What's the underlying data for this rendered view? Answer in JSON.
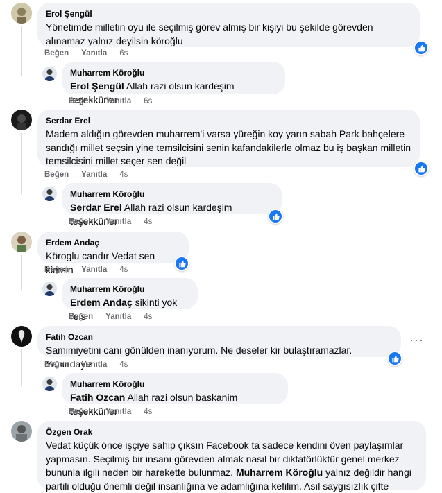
{
  "comments": [
    {
      "author": "Erol Şengül",
      "text": "Yönetimde milletin oyu ile seçilmiş görev almış bir kişiyi bu şekilde görevden alınamaz yalnız deyilsin köroğlu",
      "like": "Beğen",
      "reply": "Yanıtla",
      "time": "6s",
      "replies": [
        {
          "author": "Muharrem Köroğlu",
          "mention": "Erol Şengül",
          "text": "Allah razi olsun kardeşim teşekkürler",
          "like": "Beğen",
          "reply": "Yanıtla",
          "time": "6s"
        }
      ]
    },
    {
      "author": "Serdar Erel",
      "text": "Madem aldığın görevden muharrem'i varsa yüreğin koy yarın sabah Park bahçelere sandığı millet seçsin yine temsilcisini senin kafandakilerle olmaz bu iş başkan milletin temsilcisini millet seçer sen değil",
      "like": "Beğen",
      "reply": "Yanıtla",
      "time": "4s",
      "replies": [
        {
          "author": "Muharrem Köroğlu",
          "mention": "Serdar Erel",
          "text": "Allah razi olsun kardeşim teşekkürler",
          "like": "Beğen",
          "reply": "Yanıtla",
          "time": "4s"
        }
      ]
    },
    {
      "author": "Erdem Andaç",
      "text": "Köroglu candır Vedat sen kimsin",
      "like": "Beğen",
      "reply": "Yanıtla",
      "time": "4s",
      "replies": [
        {
          "author": "Muharrem Köroğlu",
          "mention": "Erdem Andaç",
          "text": "sikinti yok reis",
          "like": "Beğen",
          "reply": "Yanıtla",
          "time": "4s"
        }
      ]
    },
    {
      "author": "Fatih Ozcan",
      "text": "Samimiyetini canı gönülden inanıyorum. Ne deseler kir bulaştıramazlar. Yanindayiz",
      "like": "Beğen",
      "reply": "Yanıtla",
      "time": "4s",
      "replies": [
        {
          "author": "Muharrem Köroğlu",
          "mention": "Fatih Ozcan",
          "text": "Allah razi olsun baskanim teşekkürler",
          "like": "Beğen",
          "reply": "Yanıtla",
          "time": "4s"
        }
      ]
    },
    {
      "author": "Özgen Orak",
      "text_before": "Vedat küçük önce işçiye sahip çıksın Facebook ta sadece kendini öven paylaşımlar yapmasın. Seçilmiş bir insanı görevden almak nasıl bir diktatörlüktür genel merkez bununla ilgili neden bir harekette bulunmaz.",
      "mention": "Muharrem Köroğlu",
      "text_after": "yalnız değildir hangi partili olduğu önemli değil insanlığına ve adamlığına kefilim. Asıl saygısızlık çifte"
    }
  ],
  "more_options": "···",
  "colors": {
    "like_blue": "#1877f2",
    "bubble": "#f0f2f5",
    "meta": "#65676b"
  }
}
